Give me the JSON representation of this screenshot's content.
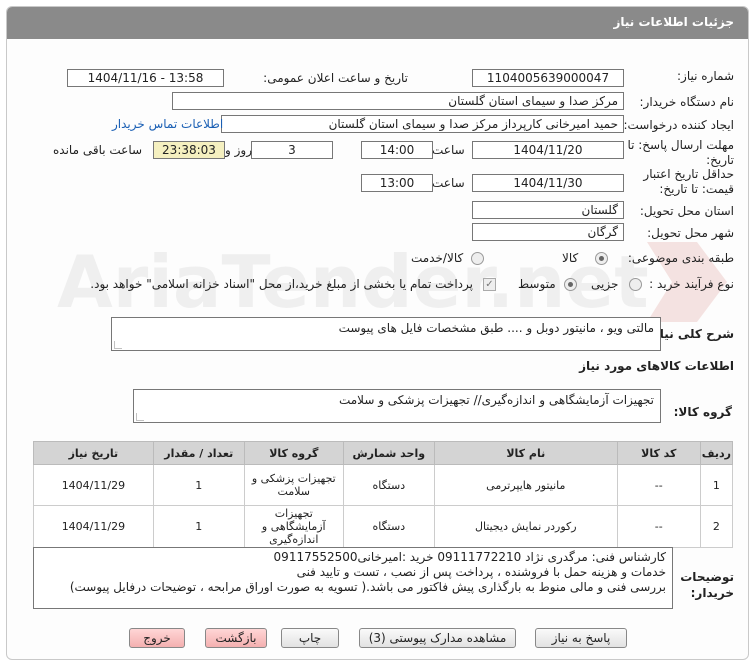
{
  "window": {
    "title": "جزئیات اطلاعات نیاز"
  },
  "form": {
    "need_number_label": "شماره نیاز:",
    "need_number": "1104005639000047",
    "announce_label": "تاریخ و ساعت اعلان عمومی:",
    "announce_value": "1404/11/16 - 13:58",
    "buyer_org_label": "نام دستگاه خریدار:",
    "buyer_org": "مرکز صدا و سیمای استان گلستان",
    "creator_label": "ایجاد کننده درخواست:",
    "creator": "حمید امیرخانی کارپرداز مرکز صدا و سیمای استان گلستان",
    "contact_link": "اطلاعات تماس خریدار",
    "deadline_label": "مهلت ارسال پاسخ: تا تاریخ:",
    "deadline_date": "1404/11/20",
    "time_label": "ساعت",
    "deadline_time": "14:00",
    "days_value": "3",
    "days_label": "روز و",
    "remaining_time": "23:38:03",
    "remaining_label": "ساعت باقی مانده",
    "validity_label": "حداقل تاریخ اعتبار قیمت: تا تاریخ:",
    "validity_date": "1404/11/30",
    "validity_time": "13:00",
    "province_label": "استان محل تحویل:",
    "province": "گلستان",
    "city_label": "شهر محل تحویل:",
    "city": "گرگان",
    "category_label": "طبقه بندی موضوعی:",
    "category_options": [
      "کالا",
      "کالا/خدمت"
    ],
    "process_label": "نوع فرآیند خرید :",
    "process_options": [
      "جزیی",
      "متوسط"
    ],
    "payment_note": "پرداخت تمام یا بخشی از مبلغ خرید،از محل \"اسناد خزانه اسلامی\" خواهد بود."
  },
  "description": {
    "label": "شرح کلی نیاز:",
    "text": "مالتی ویو ، مانیتور دوبل و .... طبق مشخصات فایل های پیوست"
  },
  "goods": {
    "heading": "اطلاعات کالاهای مورد نیاز",
    "group_label": "گروه کالا:",
    "group_value": "تجهیزات آزمایشگاهی و اندازه‌گیری// تجهیزات پزشکی و سلامت",
    "columns": [
      "ردیف",
      "کد کالا",
      "نام کالا",
      "واحد شمارش",
      "گروه کالا",
      "تعداد / مقدار",
      "تاریخ نیاز"
    ],
    "rows": [
      {
        "idx": "1",
        "code": "--",
        "name": "مانیتور هایپرترمی",
        "unit": "دستگاه",
        "group": "تجهیزات پزشکی و سلامت",
        "qty": "1",
        "date": "1404/11/29"
      },
      {
        "idx": "2",
        "code": "--",
        "name": "رکوردر نمایش دیجیتال",
        "unit": "دستگاه",
        "group": "تجهیزات آزمایشگاهی و اندازه‌گیری",
        "qty": "1",
        "date": "1404/11/29"
      }
    ]
  },
  "buyer_notes": {
    "label": "توضیحات خریدار:",
    "lines": [
      "کارشناس فنی: مرگدری نژاد 09111772210  خرید :امیرخانی09117552500",
      "خدمات و هزینه حمل با فروشنده ،  پرداخت پس از نصب ، تست و تایید فنی",
      "بررسی فنی و مالی منوط به بارگذاری پیش فاکتور می باشد.( تسویه به صورت اوراق مرابحه ، توضیحات درفایل پیوست)"
    ]
  },
  "buttons": {
    "reply": "پاسخ به نیاز",
    "attachments": "مشاهده مدارک پیوستی (3)",
    "print": "چاپ",
    "back": "بازگشت",
    "exit": "خروج"
  },
  "watermark": {
    "text": "AriaTender.net"
  }
}
